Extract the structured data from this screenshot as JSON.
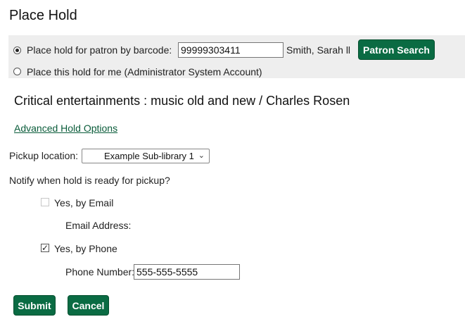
{
  "page": {
    "title": "Place Hold"
  },
  "patron": {
    "barcode_option_label": "Place hold for patron by barcode:",
    "barcode_value": "99999303411",
    "patron_name": "Smith, Sarah ll",
    "search_button": "Patron Search",
    "self_option_label": "Place this hold for me (Administrator System Account)",
    "selected_option": "barcode"
  },
  "item": {
    "title": "Critical entertainments : music old and new / Charles Rosen"
  },
  "advanced_link": "Advanced Hold Options",
  "pickup": {
    "label": "Pickup location:",
    "selected": "Example Sub-library 1"
  },
  "notify": {
    "question": "Notify when hold is ready for pickup?",
    "email_label": "Yes, by Email",
    "email_checked": false,
    "email_disabled": true,
    "email_address_label": "Email Address:",
    "phone_label": "Yes, by Phone",
    "phone_checked": true,
    "phone_number_label": "Phone Number:",
    "phone_number_value": "555-555-5555"
  },
  "actions": {
    "submit": "Submit",
    "cancel": "Cancel"
  },
  "colors": {
    "button_bg": "#0a6b43",
    "panel_bg": "#eeeeee",
    "link": "#0a5c3a"
  }
}
